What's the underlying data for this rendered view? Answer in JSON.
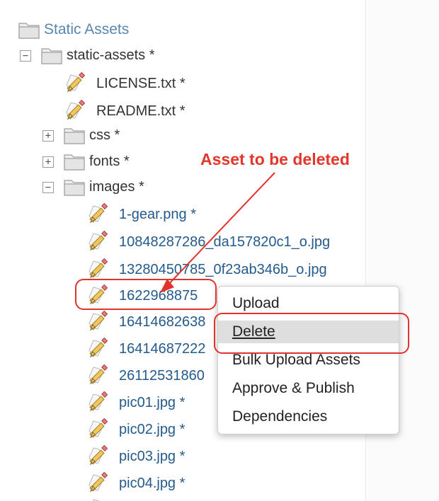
{
  "tree": {
    "root_label": "Static Assets",
    "folder_label": "static-assets *",
    "files_top": [
      "LICENSE.txt *",
      "README.txt *"
    ],
    "subfolders": [
      {
        "label": "css *",
        "toggle": "+"
      },
      {
        "label": "fonts *",
        "toggle": "+"
      },
      {
        "label": "images *",
        "toggle": "−"
      }
    ],
    "static_assets_toggle": "−",
    "images": [
      "1-gear.png *",
      "10848287286_da157820c1_o.jpg",
      "13280450785_0f23ab346b_o.jpg",
      "1622968875",
      "16414682638",
      "16414687222",
      "26112531860",
      "pic01.jpg *",
      "pic02.jpg *",
      "pic03.jpg *",
      "pic04.jpg *"
    ]
  },
  "context_menu": {
    "items": [
      "Upload",
      "Delete",
      "Bulk Upload Assets",
      "Approve & Publish",
      "Dependencies"
    ]
  },
  "annotation": {
    "text": "Asset to be deleted",
    "color": "#e3372c"
  }
}
